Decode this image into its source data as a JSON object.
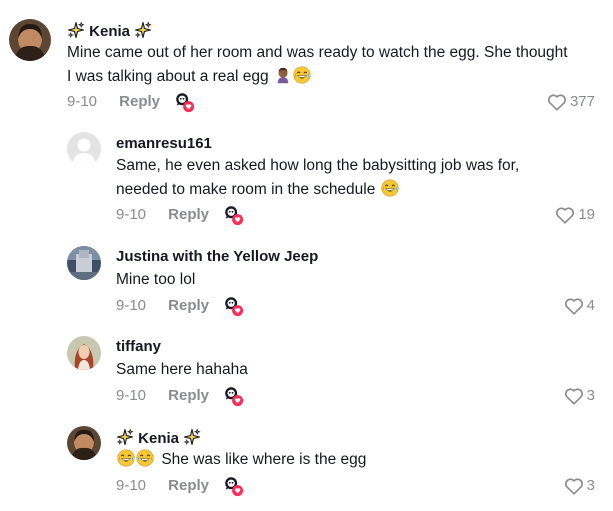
{
  "comments": [
    {
      "name": "Kenia",
      "text_lines": [
        "Mine came out of her room and was ready to watch the egg. She thought",
        "I was talking about a real egg"
      ],
      "date": "9-10",
      "reply_label": "Reply",
      "likes": "377",
      "sparkles": true,
      "emojis_end": [
        "facepalm-emoji",
        "laughing-emoji"
      ]
    },
    {
      "name": "emanresu161",
      "text_lines": [
        "Same, he even asked how long the babysitting job was for,",
        "needed to make room in the schedule"
      ],
      "date": "9-10",
      "reply_label": "Reply",
      "likes": "19",
      "emojis_end": [
        "laughing-emoji"
      ]
    },
    {
      "name": "Justina with the Yellow Jeep",
      "text_lines": [
        "Mine too lol"
      ],
      "date": "9-10",
      "reply_label": "Reply",
      "likes": "4"
    },
    {
      "name": "tiffany",
      "text_lines": [
        "Same here hahaha"
      ],
      "date": "9-10",
      "reply_label": "Reply",
      "likes": "3"
    },
    {
      "name": "Kenia",
      "text_lines": [
        "She was like where is the egg"
      ],
      "date": "9-10",
      "reply_label": "Reply",
      "likes": "3",
      "sparkles": true,
      "emojis_start": [
        "laughing-emoji",
        "laughing-emoji"
      ]
    }
  ],
  "colors": {
    "text": "#161823",
    "muted": "#8a8b91",
    "react_badge": "#fe2c55"
  }
}
